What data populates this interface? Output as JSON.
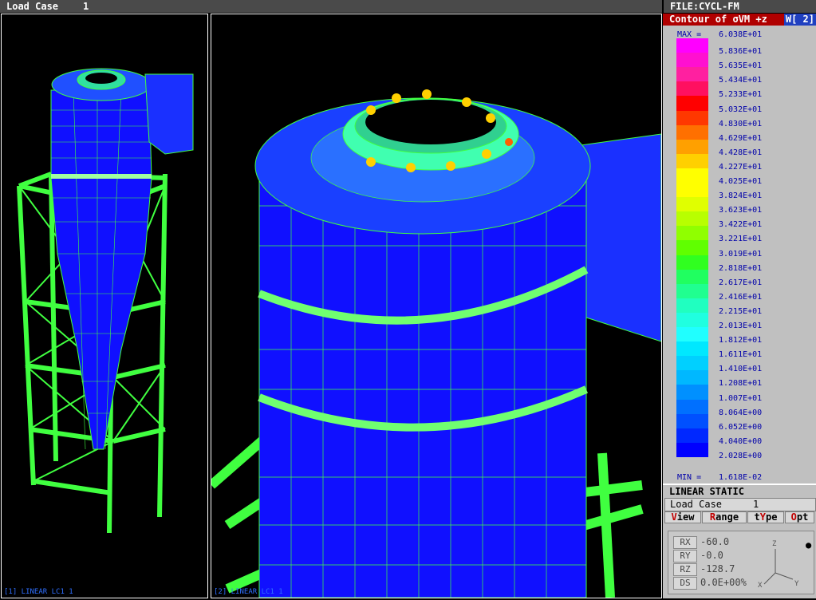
{
  "header": {
    "load_case_label": "Load Case",
    "load_case_number": "1",
    "file": "FILE:CYCL-FM"
  },
  "viewport1": {
    "label": "[1] LINEAR LC1 1"
  },
  "viewport2": {
    "label": "[2] LINEAR LC1 1"
  },
  "contour": {
    "title": "Contour of σVM +z",
    "window_tag": "W[ 2]",
    "max_label": "MAX =",
    "max_value": "6.038E+01",
    "min_label": "MIN =",
    "min_value": "1.618E-02",
    "levels": [
      "5.836E+01",
      "5.635E+01",
      "5.434E+01",
      "5.233E+01",
      "5.032E+01",
      "4.830E+01",
      "4.629E+01",
      "4.428E+01",
      "4.227E+01",
      "4.025E+01",
      "3.824E+01",
      "3.623E+01",
      "3.422E+01",
      "3.221E+01",
      "3.019E+01",
      "2.818E+01",
      "2.617E+01",
      "2.416E+01",
      "2.215E+01",
      "2.013E+01",
      "1.812E+01",
      "1.611E+01",
      "1.410E+01",
      "1.208E+01",
      "1.007E+01",
      "8.064E+00",
      "6.052E+00",
      "4.040E+00",
      "2.028E+00"
    ],
    "colors": [
      "#ff00ff",
      "#ff10d0",
      "#ff20a0",
      "#ff1060",
      "#ff0000",
      "#ff3800",
      "#ff7000",
      "#ffa000",
      "#ffd000",
      "#ffff00",
      "#ffff00",
      "#e0ff00",
      "#b8ff00",
      "#90ff00",
      "#60ff00",
      "#30ff20",
      "#20ff60",
      "#20ff90",
      "#20ffc0",
      "#20ffe0",
      "#20ffff",
      "#00e8ff",
      "#00d0ff",
      "#00b8ff",
      "#0090ff",
      "#0070ff",
      "#0050ff",
      "#0028ff",
      "#0000ff"
    ]
  },
  "status": {
    "analysis": "LINEAR STATIC",
    "load_case_label": "Load Case",
    "load_case_number": "1"
  },
  "buttons": {
    "view": {
      "hot": "V",
      "rest": "iew"
    },
    "range": {
      "hot": "R",
      "rest": "ange"
    },
    "type": {
      "pre": "t",
      "hot": "Y",
      "rest": "pe"
    },
    "opt": {
      "hot": "O",
      "rest": "pt"
    }
  },
  "rotation": {
    "rx_label": "RX",
    "rx_value": "-60.0",
    "ry_label": "RY",
    "ry_value": "-0.0",
    "rz_label": "RZ",
    "rz_value": "-128.7",
    "ds_label": "DS",
    "ds_value": "0.0E+00%",
    "axis_z": "Z",
    "axis_x": "X",
    "axis_y": "Y"
  }
}
